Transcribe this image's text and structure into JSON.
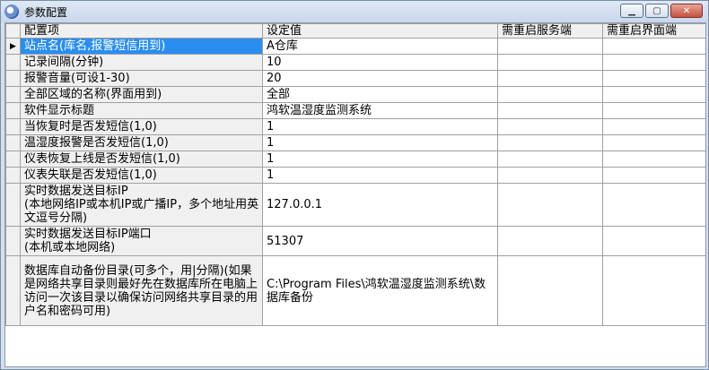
{
  "window": {
    "title": "参数配置"
  },
  "grid": {
    "columns": [
      "配置项",
      "设定值",
      "需重启服务端",
      "需重启界面端"
    ],
    "rows": [
      {
        "name": "站点名(库名,报警短信用到)",
        "value": "A仓库",
        "restart_server": "",
        "restart_ui": ""
      },
      {
        "name": "记录间隔(分钟)",
        "value": "10",
        "restart_server": "",
        "restart_ui": ""
      },
      {
        "name": "报警音量(可设1-30)",
        "value": "20",
        "restart_server": "",
        "restart_ui": ""
      },
      {
        "name": "全部区域的名称(界面用到)",
        "value": "全部",
        "restart_server": "",
        "restart_ui": ""
      },
      {
        "name": "软件显示标题",
        "value": "鸿软温湿度监测系统",
        "restart_server": "",
        "restart_ui": ""
      },
      {
        "name": "当恢复时是否发短信(1,0)",
        "value": "1",
        "restart_server": "",
        "restart_ui": ""
      },
      {
        "name": "温湿度报警是否发短信(1,0)",
        "value": "1",
        "restart_server": "",
        "restart_ui": ""
      },
      {
        "name": "仪表恢复上线是否发短信(1,0)",
        "value": "1",
        "restart_server": "",
        "restart_ui": ""
      },
      {
        "name": "仪表失联是否发短信(1,0)",
        "value": "1",
        "restart_server": "",
        "restart_ui": ""
      },
      {
        "name": "实时数据发送目标IP\n(本地网络IP或本机IP或广播IP，多个地址用英文逗号分隔)",
        "value": "127.0.0.1",
        "restart_server": "",
        "restart_ui": ""
      },
      {
        "name": "实时数据发送目标IP端口\n(本机或本地网络)",
        "value": "51307",
        "restart_server": "",
        "restart_ui": ""
      },
      {
        "name": "数据库自动备份目录(可多个，用|分隔)(如果是网络共享目录则最好先在数据库所在电脑上访问一次该目录以确保访问网络共享目录的用户名和密码可用)",
        "value": "C:\\Program Files\\鸿软温湿度监测系统\\数据库备份",
        "restart_server": "",
        "restart_ui": ""
      }
    ]
  }
}
